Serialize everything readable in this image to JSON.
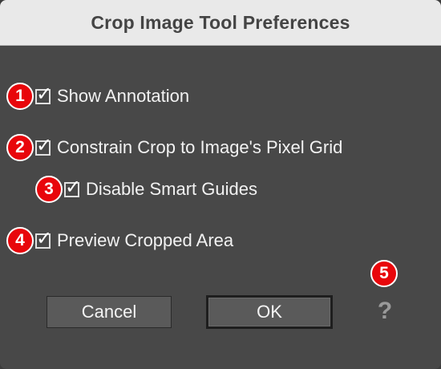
{
  "window": {
    "title": "Crop Image Tool Preferences"
  },
  "options": [
    {
      "badge": "1",
      "label": "Show Annotation",
      "checked": true
    },
    {
      "badge": "2",
      "label": "Constrain Crop to Image's Pixel Grid",
      "checked": true
    },
    {
      "badge": "3",
      "label": "Disable Smart Guides",
      "checked": true
    },
    {
      "badge": "4",
      "label": "Preview Cropped Area",
      "checked": true
    }
  ],
  "buttons": {
    "cancel_label": "Cancel",
    "ok_label": "OK",
    "help_badge": "5",
    "help_label": "?"
  },
  "colors": {
    "dialog_bg": "#484848",
    "titlebar_bg": "#e9e9e9",
    "badge_red": "#e8060b",
    "text": "#f2f2f2"
  },
  "icons": {
    "check": "checkmark-icon",
    "help": "question-mark-icon"
  }
}
